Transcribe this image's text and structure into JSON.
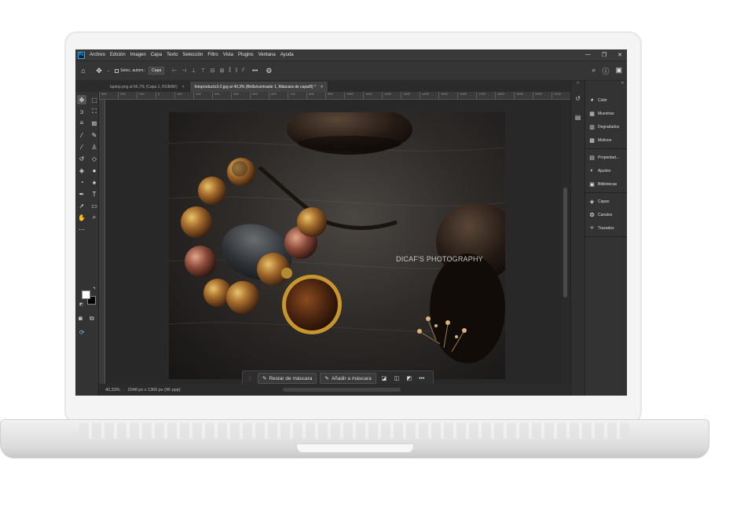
{
  "menubar": {
    "app_icon": "Ps",
    "items": [
      "Archivo",
      "Edición",
      "Imagen",
      "Capa",
      "Texto",
      "Selección",
      "Filtro",
      "Vista",
      "Plugins",
      "Ventana",
      "Ayuda"
    ],
    "window_controls": [
      "—",
      "❐",
      "✕"
    ]
  },
  "options": {
    "auto_select_label": "Selec. autom.:",
    "layer_select_value": "Capa",
    "more": "•••"
  },
  "tabs": [
    {
      "label": "laptop.png al 66,7% (Capa 1, RGB/8#)",
      "close": "×"
    },
    {
      "label": "fotoproducto3-2.jpg al 40,3% (Brillo/contraste 1, Máscara de capa/8) *",
      "close": "×"
    }
  ],
  "ruler": {
    "ticks": [
      "300",
      "200",
      "100",
      "0",
      "100",
      "200",
      "300",
      "400",
      "500",
      "600",
      "700",
      "800",
      "900",
      "1000",
      "1100",
      "1200",
      "1300",
      "1400",
      "1500",
      "1600",
      "1700",
      "1800",
      "1900",
      "2000",
      "2100"
    ]
  },
  "canvas": {
    "watermark": "DICAF'S PHOTOGRAPHY"
  },
  "contextbar": {
    "subtract_mask": "Restar de máscara",
    "add_mask": "Añadir a máscara",
    "more": "•••"
  },
  "status": {
    "zoom": "40,33%",
    "doc_info": "2048 px x 1365 px (96 ppp)"
  },
  "panels": {
    "collapse": "»",
    "group1": [
      "Color",
      "Muestras",
      "Degradados",
      "Motivos"
    ],
    "group2": [
      "Propiedad...",
      "Ajustes",
      "Bibliotecas"
    ],
    "group3": [
      "Capas",
      "Canales",
      "Trazados"
    ]
  },
  "colors": {
    "accent": "#31a8ff",
    "ui_dark": "#333333",
    "foreground": "#ffffff",
    "background": "#000000"
  }
}
